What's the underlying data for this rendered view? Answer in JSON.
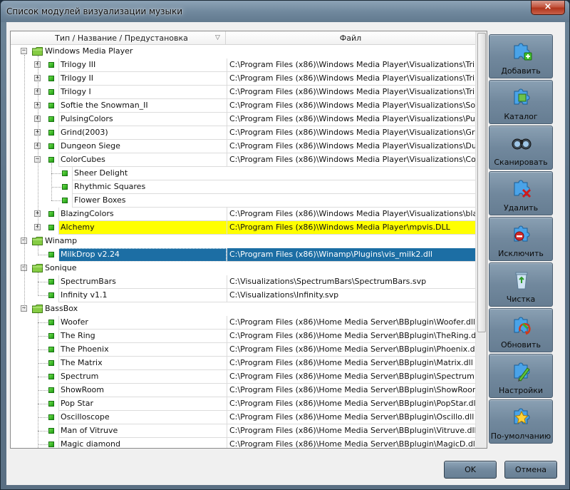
{
  "window": {
    "title": "Список модулей визуализации музыки",
    "close_glyph": "×"
  },
  "columns": {
    "name": "Тип / Название / Предустановка",
    "sort_glyph": "▽",
    "file": "Файл"
  },
  "tree": [
    {
      "kind": "group",
      "label": "Windows Media Player",
      "expanded": true
    },
    {
      "kind": "plugin",
      "label": "Trilogy III",
      "file": "C:\\Program Files (x86)\\Windows Media Player\\Visualizations\\Trilogy III.d",
      "expanded": false
    },
    {
      "kind": "plugin",
      "label": "Trilogy II",
      "file": "C:\\Program Files (x86)\\Windows Media Player\\Visualizations\\Trilogy II.dl",
      "expanded": false
    },
    {
      "kind": "plugin",
      "label": "Trilogy I",
      "file": "C:\\Program Files (x86)\\Windows Media Player\\Visualizations\\Trilogy I.dll",
      "expanded": false
    },
    {
      "kind": "plugin",
      "label": "Softie the Snowman_II",
      "file": "C:\\Program Files (x86)\\Windows Media Player\\Visualizations\\SoftietheSn",
      "expanded": false
    },
    {
      "kind": "plugin",
      "label": "PulsingColors",
      "file": "C:\\Program Files (x86)\\Windows Media Player\\Visualizations\\Pulsing.dll",
      "expanded": false
    },
    {
      "kind": "plugin",
      "label": "Grind(2003)",
      "file": "C:\\Program Files (x86)\\Windows Media Player\\Visualizations\\Grind.dll",
      "expanded": false
    },
    {
      "kind": "plugin",
      "label": "Dungeon Siege",
      "file": "C:\\Program Files (x86)\\Windows Media Player\\Visualizations\\Dungeon Si",
      "expanded": false
    },
    {
      "kind": "plugin",
      "label": "ColorCubes",
      "file": "C:\\Program Files (x86)\\Windows Media Player\\Visualizations\\ColorCub.d",
      "expanded": true
    },
    {
      "kind": "preset",
      "label": "Sheer Delight"
    },
    {
      "kind": "preset",
      "label": "Rhythmic Squares"
    },
    {
      "kind": "preset",
      "label": "Flower Boxes"
    },
    {
      "kind": "plugin",
      "label": "BlazingColors",
      "file": "C:\\Program Files (x86)\\Windows Media Player\\Visualizations\\blaze.dll",
      "expanded": false
    },
    {
      "kind": "plugin",
      "label": "Alchemy",
      "file": "C:\\Program Files (x86)\\Windows Media Player\\mpvis.DLL",
      "expanded": false,
      "highlight": "yellow"
    },
    {
      "kind": "group",
      "label": "Winamp",
      "expanded": true
    },
    {
      "kind": "plugin",
      "label": "MilkDrop v2.24",
      "file": "C:\\Program Files (x86)\\Winamp\\Plugins\\vis_milk2.dll",
      "highlight": "selected"
    },
    {
      "kind": "group",
      "label": "Sonique",
      "expanded": true
    },
    {
      "kind": "plugin",
      "label": "SpectrumBars",
      "file": "C:\\Visualizations\\SpectrumBars\\SpectrumBars.svp"
    },
    {
      "kind": "plugin",
      "label": "Infinity v1.1",
      "file": "C:\\Visualizations\\Infinity.svp"
    },
    {
      "kind": "group",
      "label": "BassBox",
      "expanded": true
    },
    {
      "kind": "plugin",
      "label": "Woofer",
      "file": "C:\\Program Files (x86)\\Home Media Server\\BBplugin\\Woofer.dll"
    },
    {
      "kind": "plugin",
      "label": "The Ring",
      "file": "C:\\Program Files (x86)\\Home Media Server\\BBplugin\\TheRing.dll"
    },
    {
      "kind": "plugin",
      "label": "The Phoenix",
      "file": "C:\\Program Files (x86)\\Home Media Server\\BBplugin\\Phoenix.dll"
    },
    {
      "kind": "plugin",
      "label": "The Matrix",
      "file": "C:\\Program Files (x86)\\Home Media Server\\BBplugin\\Matrix.dll"
    },
    {
      "kind": "plugin",
      "label": "Spectrum",
      "file": "C:\\Program Files (x86)\\Home Media Server\\BBplugin\\Spectrum.dll"
    },
    {
      "kind": "plugin",
      "label": "ShowRoom",
      "file": "C:\\Program Files (x86)\\Home Media Server\\BBplugin\\ShowRoom.dll"
    },
    {
      "kind": "plugin",
      "label": "Pop Star",
      "file": "C:\\Program Files (x86)\\Home Media Server\\BBplugin\\PopStar.dll"
    },
    {
      "kind": "plugin",
      "label": "Oscilloscope",
      "file": "C:\\Program Files (x86)\\Home Media Server\\BBplugin\\Oscillo.dll"
    },
    {
      "kind": "plugin",
      "label": "Man of Vitruve",
      "file": "C:\\Program Files (x86)\\Home Media Server\\BBplugin\\Vitruve.dll"
    },
    {
      "kind": "plugin",
      "label": "Magic diamond",
      "file": "C:\\Program Files (x86)\\Home Media Server\\BBplugin\\MagicD.dll"
    }
  ],
  "side_buttons": [
    {
      "label": "Добавить",
      "icon": "puzzle-add-icon"
    },
    {
      "label": "Каталог",
      "icon": "puzzle-catalog-icon"
    },
    {
      "label": "Сканировать",
      "icon": "binoculars-icon"
    },
    {
      "label": "Удалить",
      "icon": "puzzle-delete-icon"
    },
    {
      "label": "Исключить",
      "icon": "puzzle-exclude-icon"
    },
    {
      "label": "Чистка",
      "icon": "recycle-bin-icon"
    },
    {
      "label": "Обновить",
      "icon": "puzzle-refresh-icon"
    },
    {
      "label": "Настройки",
      "icon": "puzzle-settings-icon"
    },
    {
      "label": "По-умолчанию",
      "icon": "puzzle-star-icon"
    }
  ],
  "footer": {
    "ok_label": "OK",
    "cancel_label": "Отмена"
  },
  "colors": {
    "highlight_yellow": "#ffff00",
    "selection_blue": "#1c6ea4",
    "plugin_square_green": "#2fae1c",
    "folder_green": "#7cc43a"
  }
}
